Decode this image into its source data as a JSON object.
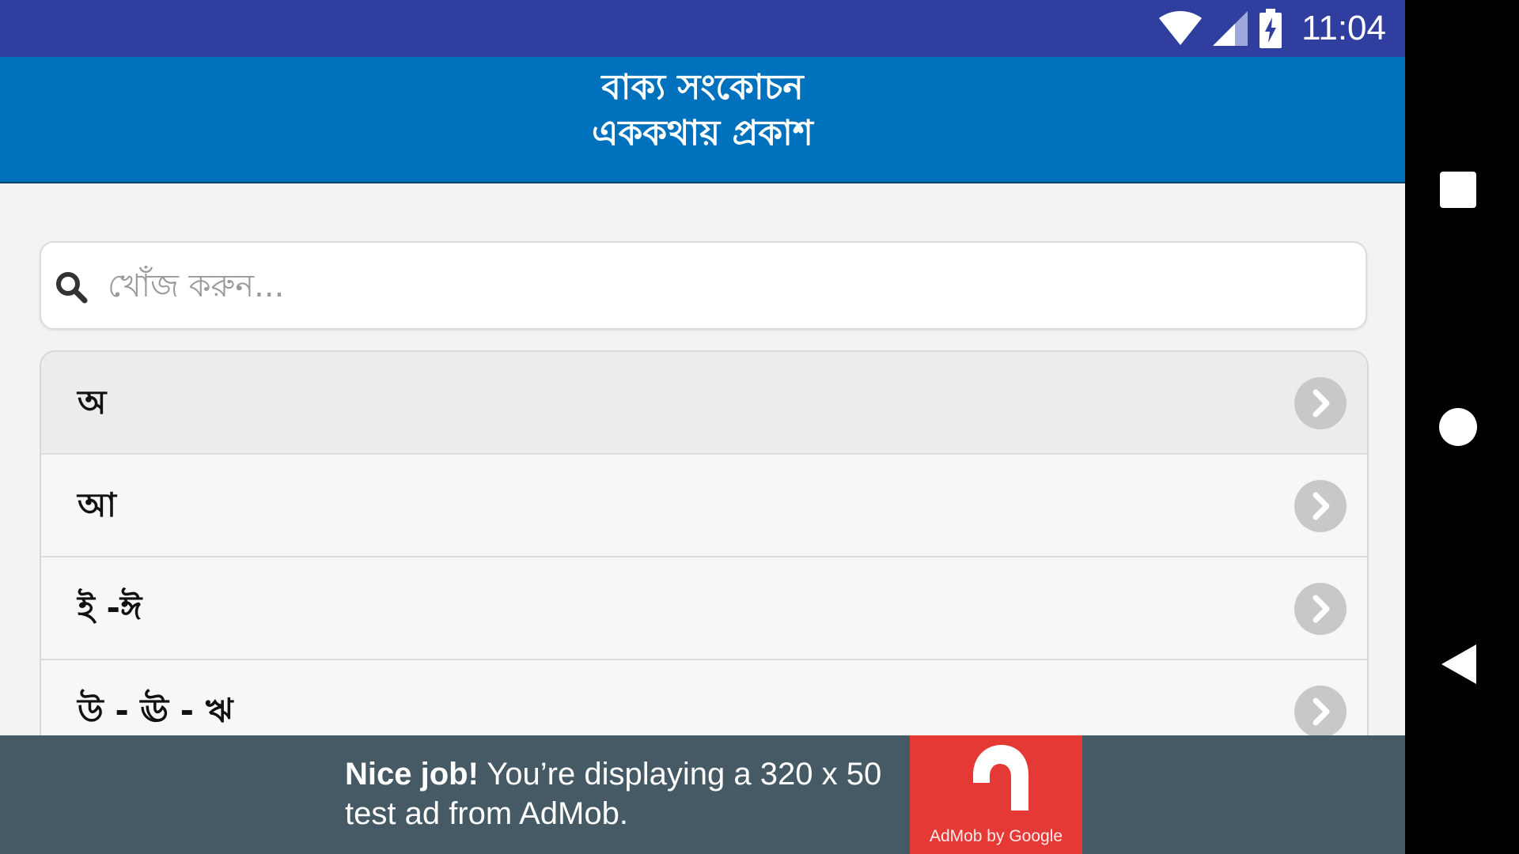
{
  "status_bar": {
    "time": "11:04",
    "icons": [
      "wifi-icon",
      "cellular-signal-icon",
      "battery-charging-icon"
    ],
    "color": "#303f9f"
  },
  "header": {
    "title_line1": "বাক্য সংকোচন",
    "title_line2": "এককথায় প্রকাশ",
    "color": "#0071bc"
  },
  "search": {
    "icon": "search-icon",
    "placeholder": "খোঁজ করুন..."
  },
  "list": {
    "items": [
      {
        "label": "অ"
      },
      {
        "label": "আ"
      },
      {
        "label": "ই -ঈ"
      },
      {
        "label": "উ - ঊ - ঋ"
      }
    ],
    "item_icon": "chevron-right-icon"
  },
  "ad": {
    "bold": "Nice job!",
    "text": " You’re displaying a 320 x 50 test ad from AdMob.",
    "logo_caption": "AdMob by Google",
    "background": "#455a64",
    "logo_color": "#e53935"
  },
  "nav_bar": {
    "buttons": [
      "recents-square-icon",
      "home-circle-icon",
      "back-triangle-icon"
    ]
  }
}
